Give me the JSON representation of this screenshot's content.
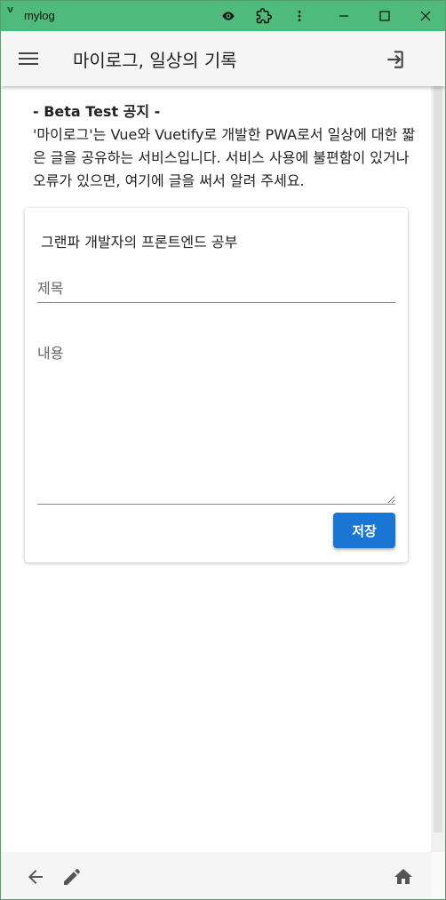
{
  "window": {
    "title": "mylog",
    "logo": "v"
  },
  "colors": {
    "titlebar": "#4fbb7a",
    "primary": "#1976d2",
    "icon": "#444444"
  },
  "titlebar": {
    "icons": [
      "eye-icon",
      "extension-icon",
      "more-vert-icon",
      "minimize-icon",
      "maximize-icon",
      "close-icon"
    ]
  },
  "appbar": {
    "title": "마이로그, 일상의 기록",
    "menu_icon": "menu-icon",
    "logout_icon": "logout-icon"
  },
  "notice": {
    "title": "- Beta Test 공지 -",
    "body": "'마이로그'는 Vue와 Vuetify로 개발한 PWA로서 일상에 대한 짧은 글을 공유하는 서비스입니다. 서비스 사용에 불편함이 있거나 오류가 있으면, 여기에 글을 써서 알려 주세요."
  },
  "form": {
    "card_title": "그랜파 개발자의 프론트엔드 공부",
    "title_placeholder": "제목",
    "title_value": "",
    "content_placeholder": "내용",
    "content_value": "",
    "save_label": "저장"
  },
  "bottom_nav": {
    "icons": [
      "back-arrow-icon",
      "edit-icon",
      "home-icon"
    ]
  }
}
